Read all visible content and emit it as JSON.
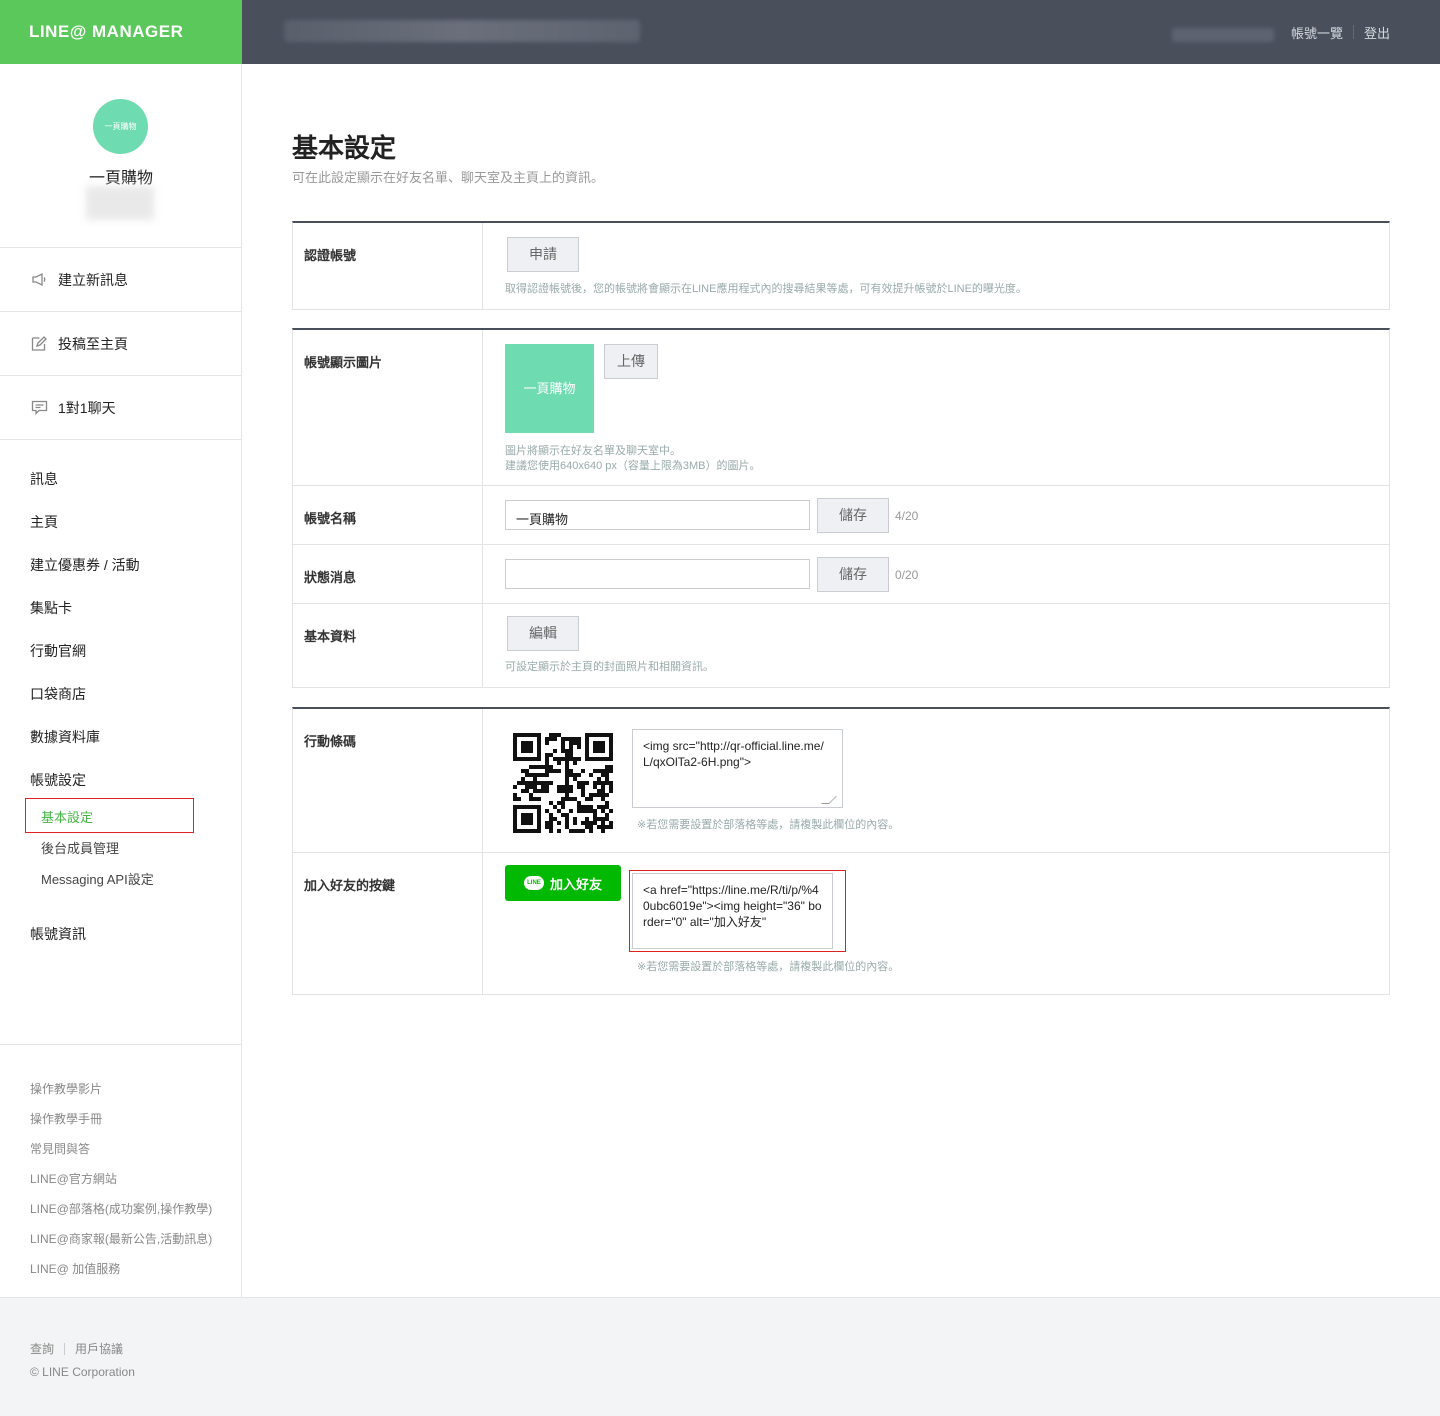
{
  "header": {
    "brand": "LINE@ MANAGER",
    "link_accounts": "帳號一覽",
    "link_logout": "登出"
  },
  "sidebar": {
    "avatar_text": "一頁購物",
    "account_name": "一頁購物",
    "quick_actions": [
      {
        "label": "建立新訊息",
        "icon": "megaphone-icon"
      },
      {
        "label": "投稿至主頁",
        "icon": "edit-icon"
      },
      {
        "label": "1對1聊天",
        "icon": "chat-icon"
      }
    ],
    "menu": [
      "訊息",
      "主頁",
      "建立優惠券 / 活動",
      "集點卡",
      "行動官網",
      "口袋商店",
      "數據資料庫",
      "帳號設定"
    ],
    "submenu": [
      "基本設定",
      "後台成員管理",
      "Messaging API設定"
    ],
    "menu_after": "帳號資訊",
    "help_links": [
      "操作教學影片",
      "操作教學手冊",
      "常見問與答",
      "LINE@官方網站",
      "LINE@部落格(成功案例,操作教學)",
      "LINE@商家報(最新公告,活動訊息)",
      "LINE@ 加值服務"
    ]
  },
  "footer": {
    "inquiry": "查詢",
    "terms": "用戶協議",
    "copyright": "© LINE Corporation"
  },
  "main": {
    "title": "基本設定",
    "subtitle": "可在此設定顯示在好友名單、聊天室及主頁上的資訊。",
    "verify": {
      "label": "認證帳號",
      "button": "申請",
      "hint": "取得認證帳號後，您的帳號將會顯示在LINE應用程式內的搜尋結果等處，可有效提升帳號於LINE的曝光度。"
    },
    "profile_image": {
      "label": "帳號顯示圖片",
      "thumb_text": "一頁購物",
      "button": "上傳",
      "hint_line1": "圖片將顯示在好友名單及聊天室中。",
      "hint_line2": "建議您使用640x640 px（容量上限為3MB）的圖片。"
    },
    "account_name": {
      "label": "帳號名稱",
      "value": "一頁購物",
      "button": "儲存",
      "count": "4/20"
    },
    "status_message": {
      "label": "狀態消息",
      "value": "",
      "button": "儲存",
      "count": "0/20"
    },
    "basic_info": {
      "label": "基本資料",
      "button": "編輯",
      "hint": "可設定顯示於主頁的封面照片和相關資訊。"
    },
    "qr_code": {
      "label": "行動條碼",
      "code": "<img src=\"http://qr-official.line.me/L/qxOlTa2-6H.png\">",
      "hint": "※若您需要設置於部落格等處，請複製此欄位的內容。"
    },
    "add_friend": {
      "label": "加入好友的按鍵",
      "badge": "LINE",
      "button": "加入好友",
      "code": "<a href=\"https://line.me/R/ti/p/%40ubc6019e\"><img height=\"36\" border=\"0\" alt=\"加入好友\"",
      "hint": "※若您需要設置於部落格等處，請複製此欄位的內容。"
    }
  },
  "colors": {
    "brand_green": "#5ac85a",
    "header_dark": "#4a4f5c",
    "avatar_mint": "#6fdbb0",
    "line_green": "#00b900",
    "highlight_red": "#dd2222"
  }
}
